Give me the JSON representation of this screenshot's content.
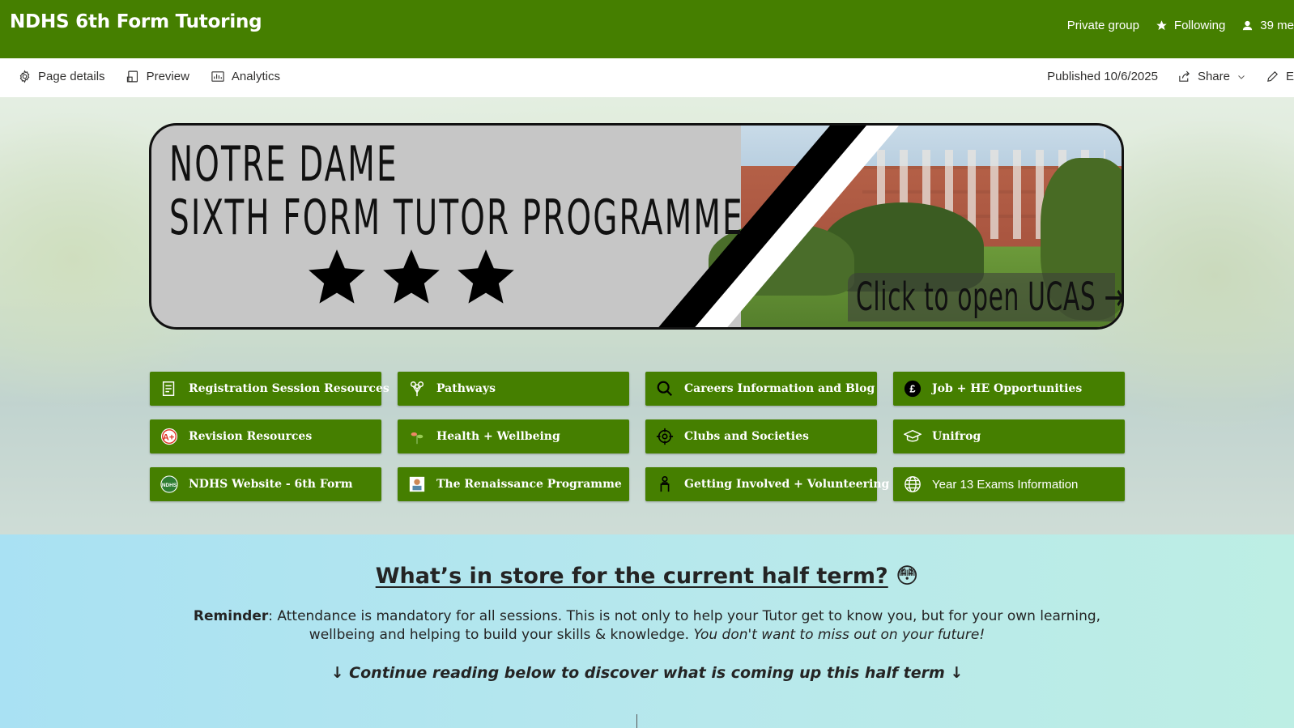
{
  "header": {
    "title": "NDHS 6th Form Tutoring",
    "privacy": "Private group",
    "follow_label": "Following",
    "members_label": "39 me"
  },
  "command_bar": {
    "page_details": "Page details",
    "preview": "Preview",
    "analytics": "Analytics",
    "published": "Published 10/6/2025",
    "share": "Share",
    "edit_label": "E"
  },
  "banner": {
    "line1": "NOTRE DAME",
    "line2": "SIXTH FORM TUTOR PROGRAMME",
    "cta": "Click to open UCAS →"
  },
  "quick_links": [
    {
      "label": "Registration Session Resources",
      "icon": "clipboard-icon"
    },
    {
      "label": "Pathways",
      "icon": "flowers-icon"
    },
    {
      "label": "Careers Information and Blog",
      "icon": "search-icon"
    },
    {
      "label": "Job + HE Opportunities",
      "icon": "pound-icon"
    },
    {
      "label": "Revision Resources",
      "icon": "a-plus-icon"
    },
    {
      "label": "Health + Wellbeing",
      "icon": "plant-icon"
    },
    {
      "label": "Clubs and Societies",
      "icon": "target-icon"
    },
    {
      "label": "Unifrog",
      "icon": "graduation-cap-icon"
    },
    {
      "label": "NDHS Website - 6th Form",
      "icon": "school-crest-icon"
    },
    {
      "label": "The Renaissance Programme",
      "icon": "renaissance-icon"
    },
    {
      "label": "Getting Involved + Volunteering",
      "icon": "volunteer-icon"
    },
    {
      "label": "Year 13 Exams Information",
      "icon": "globe-icon"
    }
  ],
  "section": {
    "heading": "What’s in store for the current half term?",
    "emoji": "😳",
    "reminder_label": "Reminder",
    "reminder_text": ": Attendance is mandatory for all sessions. This is not only to help your Tutor get to know you, but for your own learning, wellbeing and helping to build your skills & knowledge. ",
    "reminder_italic": "You don't want to miss out on your future!",
    "continue_text": "↓ Continue reading below to discover what is coming up this half term ↓"
  },
  "colors": {
    "brand_green": "#457f00",
    "section_bg_start": "#a9e1f3",
    "section_bg_end": "#bdeee4"
  }
}
